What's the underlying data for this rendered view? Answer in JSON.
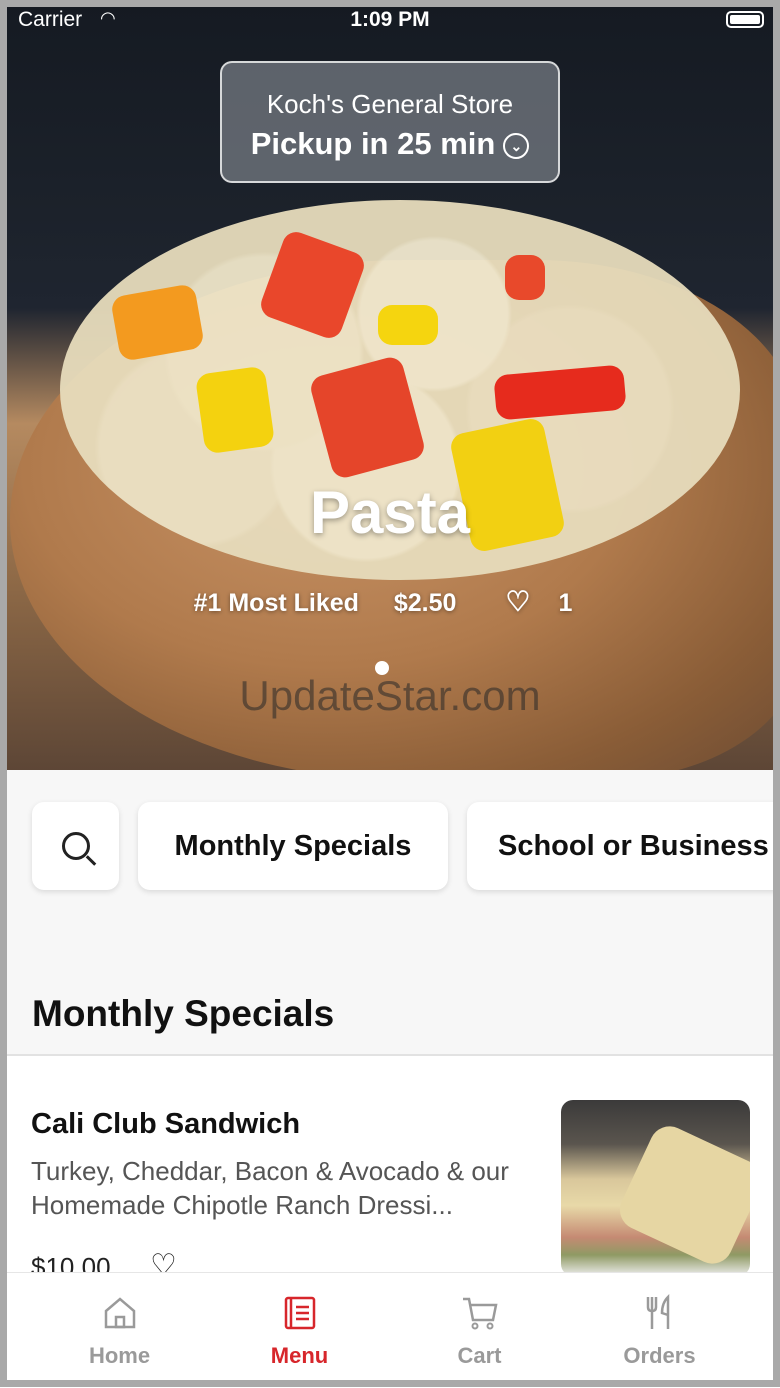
{
  "status_bar": {
    "carrier": "Carrier",
    "time": "1:09 PM"
  },
  "store": {
    "name": "Koch's General Store",
    "pickup": "Pickup in 25 min"
  },
  "hero": {
    "title": "Pasta",
    "rank": "#1 Most Liked",
    "price": "$2.50",
    "likes": "1",
    "watermark": "UpdateStar.com"
  },
  "categories": {
    "first": "Monthly Specials",
    "second": "School or Business"
  },
  "section": {
    "title": "Monthly Specials"
  },
  "item": {
    "name": "Cali Club Sandwich",
    "description": "Turkey, Cheddar, Bacon & Avocado & our Homemade Chipotle Ranch Dressi...",
    "price": "$10.00"
  },
  "tabs": [
    {
      "label": "Home",
      "icon": "home-icon"
    },
    {
      "label": "Menu",
      "icon": "menu-icon"
    },
    {
      "label": "Cart",
      "icon": "cart-icon"
    },
    {
      "label": "Orders",
      "icon": "utensils-icon"
    }
  ],
  "colors": {
    "accent": "#d7262b",
    "inactive": "#9a9a9a"
  }
}
